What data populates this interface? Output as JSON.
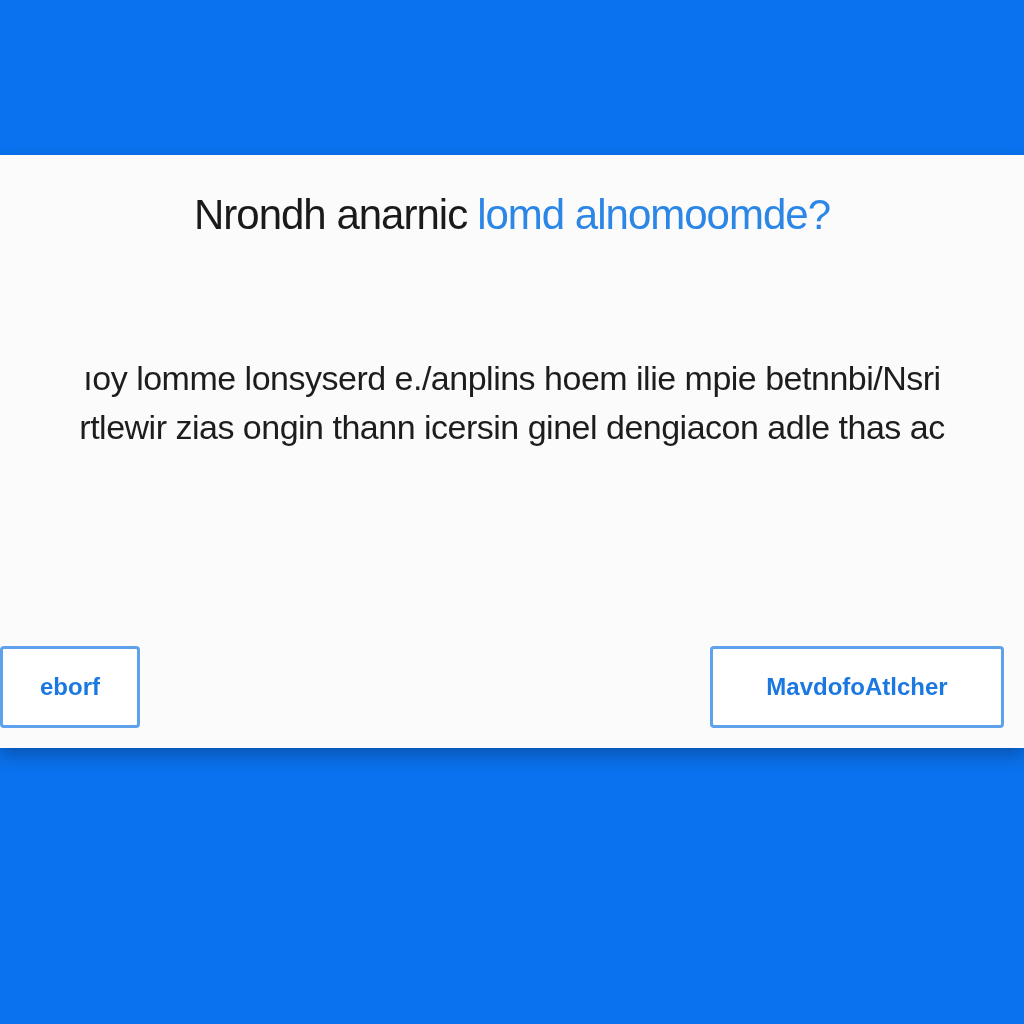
{
  "dialog": {
    "title": {
      "plain": "Nrondh anarnic",
      "accent": "lomd alnomoomde?"
    },
    "message_lines": [
      "ıoy lomme lonsyserd e./anplins hoem ilie mpie betnnbi/Nsri",
      "rtlewir zias ongin thann icersin ginel dengiacon adle thas ac"
    ],
    "buttons": [
      {
        "label": "eborf"
      },
      {
        "label": "MavdofoAtlcher"
      }
    ]
  }
}
